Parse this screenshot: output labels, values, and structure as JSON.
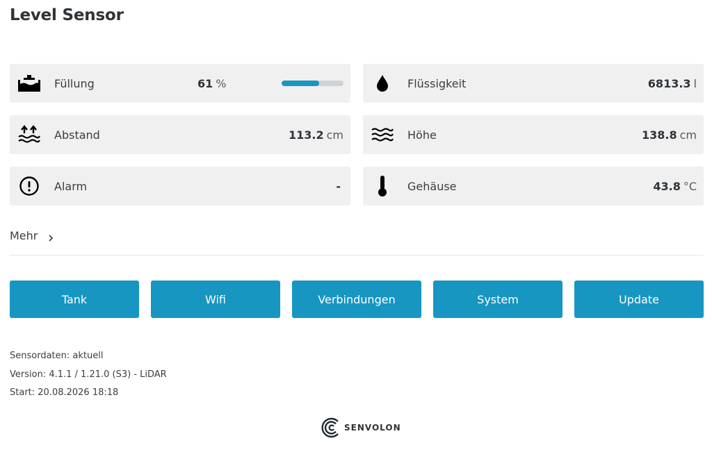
{
  "page": {
    "title": "Level Sensor"
  },
  "tiles": [
    {
      "icon": "tank-icon",
      "label": "Füllung",
      "value": "61",
      "unit": "%",
      "fill_percent": 61
    },
    {
      "icon": "drop-icon",
      "label": "Flüssigkeit",
      "value": "6813.3",
      "unit": "l"
    },
    {
      "icon": "distance-up-arrows-icon",
      "label": "Abstand",
      "value": "113.2",
      "unit": "cm"
    },
    {
      "icon": "waves-icon",
      "label": "Höhe",
      "value": "138.8",
      "unit": "cm"
    },
    {
      "icon": "alert-circle-icon",
      "label": "Alarm",
      "value": "-",
      "unit": ""
    },
    {
      "icon": "thermometer-icon",
      "label": "Gehäuse",
      "value": "43.8",
      "unit": "°C"
    }
  ],
  "more": {
    "label": "Mehr"
  },
  "buttons": [
    {
      "label": "Tank"
    },
    {
      "label": "Wifi"
    },
    {
      "label": "Verbindungen"
    },
    {
      "label": "System"
    },
    {
      "label": "Update"
    }
  ],
  "footer": {
    "sensordata": "Sensordaten: aktuell",
    "version": "Version: 4.1.1 / 1.21.0 (S3) - LiDAR",
    "start": "Start: 20.08.2026 18:18"
  },
  "logo": {
    "wordmark": "SENVOLON"
  },
  "colors": {
    "accent": "#1796c2",
    "tile_bg": "#f0f0f1",
    "text": "#2e3338"
  }
}
